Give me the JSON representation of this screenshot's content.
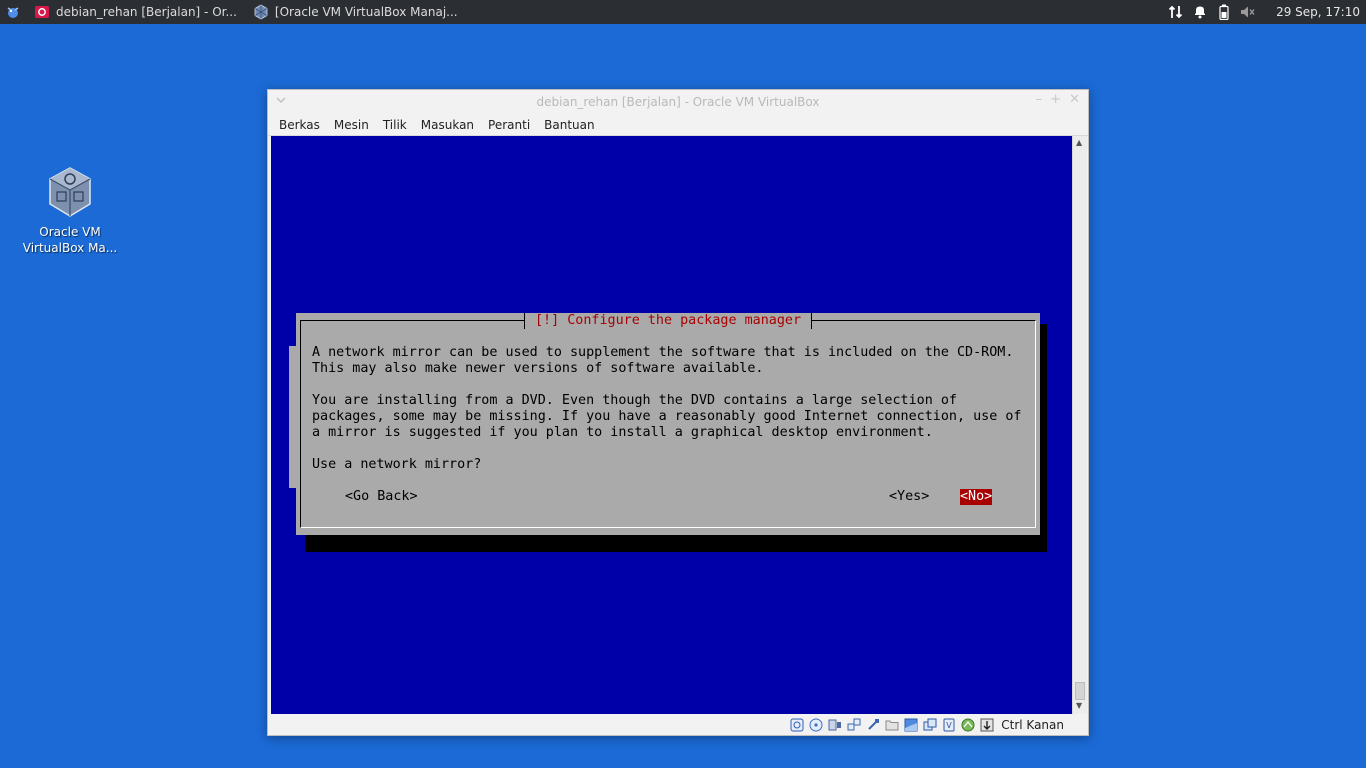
{
  "panel": {
    "tasks": [
      {
        "label": "debian_rehan [Berjalan] - Or..."
      },
      {
        "label": "[Oracle VM VirtualBox Manaj..."
      }
    ],
    "clock": "29 Sep, 17:10"
  },
  "desktop": {
    "icon_label_line1": "Oracle VM",
    "icon_label_line2": "VirtualBox Ma..."
  },
  "window": {
    "title": "debian_rehan [Berjalan] - Oracle VM VirtualBox",
    "menu": [
      "Berkas",
      "Mesin",
      "Tilik",
      "Masukan",
      "Peranti",
      "Bantuan"
    ],
    "host_key": "Ctrl Kanan"
  },
  "dialog": {
    "title": "[!] Configure the package manager",
    "para1_line1": "A network mirror can be used to supplement the software that is included on the CD-ROM.",
    "para1_line2": "This may also make newer versions of software available.",
    "para2_line1": "You are installing from a DVD. Even though the DVD contains a large selection of",
    "para2_line2": "packages, some may be missing. If you have a reasonably good Internet connection, use of",
    "para2_line3": "a mirror is suggested if you plan to install a graphical desktop environment.",
    "question": "Use a network mirror?",
    "btn_back": "<Go Back>",
    "btn_yes": "<Yes>",
    "btn_no": "<No>"
  },
  "colors": {
    "desktop_bg": "#1b6ad6",
    "vm_bg": "#0000a8",
    "dialog_bg": "#aaaaaa",
    "accent_red": "#a80000"
  }
}
